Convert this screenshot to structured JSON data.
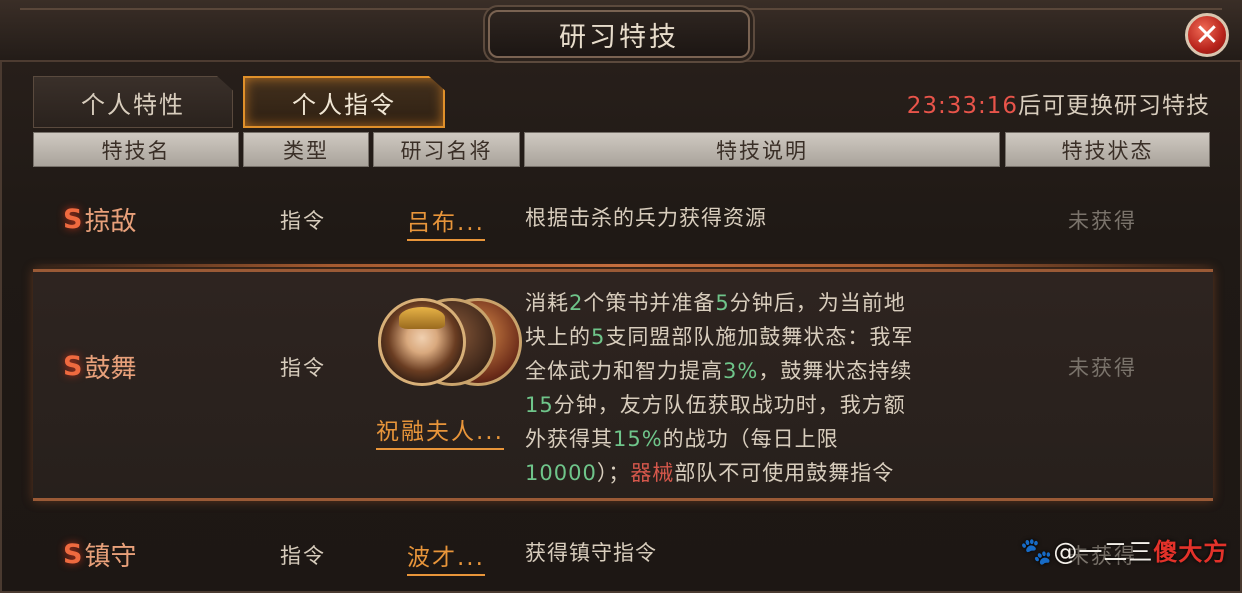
{
  "window": {
    "title": "研习特技",
    "close_glyph": "✕"
  },
  "tabs": [
    {
      "label": "个人特性",
      "active": false
    },
    {
      "label": "个人指令",
      "active": true
    }
  ],
  "timer": {
    "time": "23:33:16",
    "suffix": "后可更换研习特技"
  },
  "columns": [
    "特技名",
    "类型",
    "研习名将",
    "特技说明",
    "特技状态"
  ],
  "rows": [
    {
      "grade": "S",
      "name": "掠敌",
      "type": "指令",
      "general": "吕布...",
      "description": "根据击杀的兵力获得资源",
      "status": "未获得"
    },
    {
      "grade": "S",
      "name": "鼓舞",
      "type": "指令",
      "general": "祝融夫人...",
      "description_parts": {
        "l1a": "消耗",
        "l1b": "2",
        "l1c": "个策书并准备",
        "l1d": "5",
        "l1e": "分钟后，为当前地",
        "l2a": "块上的",
        "l2b": "5",
        "l2c": "支同盟部队施加鼓舞状态：我军",
        "l3a": "全体武力和智力提高",
        "l3b": "3%",
        "l3c": "，鼓舞状态持续",
        "l4a": "15",
        "l4b": "分钟，友方队伍获取战功时，我方额",
        "l5a": "外获得其",
        "l5b": "15%",
        "l5c": "的战功（每日上限",
        "l6a": "10000",
        "l6b": "）；",
        "l6c": "器械",
        "l6d": "部队不可使用鼓舞指令"
      },
      "status": "未获得"
    },
    {
      "grade": "S",
      "name": "镇守",
      "type": "指令",
      "general": "波才...",
      "description": "获得镇守指令",
      "status": "未获得"
    }
  ],
  "watermark": {
    "paw": "🐾",
    "text": "@一二三",
    "brand": "傻大方"
  }
}
